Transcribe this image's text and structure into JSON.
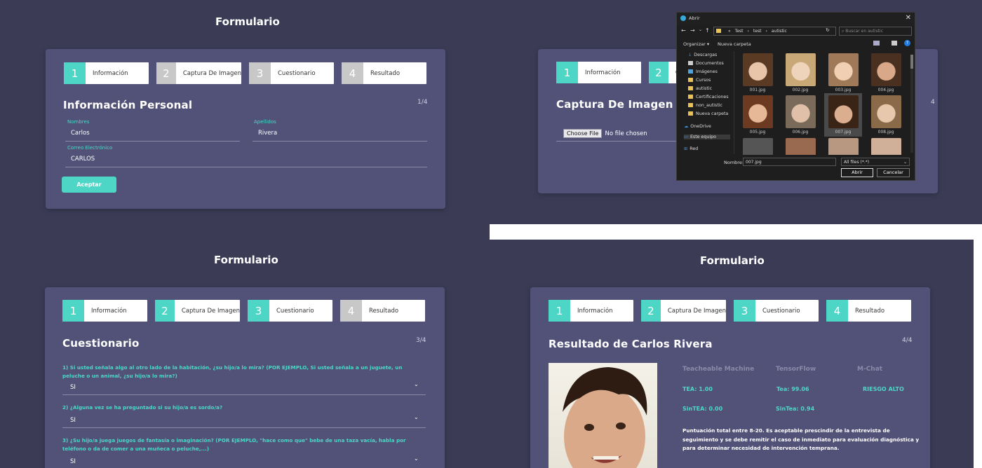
{
  "steps": [
    "Información",
    "Captura De Imagen",
    "Cuestionario",
    "Resultado"
  ],
  "step_nums": [
    "1",
    "2",
    "3",
    "4"
  ],
  "p1": {
    "title": "Formulario",
    "section": "Información Personal",
    "page": "1/4",
    "nombres_label": "Nombres",
    "nombres_value": "Carlos",
    "apellidos_label": "Apellidos",
    "apellidos_value": "Rivera",
    "correo_label": "Correo Electrónico",
    "correo_value": "CARLOS",
    "accept": "Aceptar"
  },
  "p2": {
    "section": "Captura De Imagen",
    "page": "4",
    "choose": "Choose File",
    "nofile": "No file chosen",
    "dialog": {
      "title": "Abrir",
      "crumbs": [
        "«",
        "Test",
        "test",
        "autistic"
      ],
      "search_placeholder": "Buscar en autistic",
      "organize": "Organizar ▾",
      "new_folder": "Nueva carpeta",
      "nav": [
        "Descargas",
        "Documentos",
        "Imágenes",
        "Cursos",
        "autistic",
        "Certificaciones",
        "non_autistic",
        "Nueva carpeta",
        "OneDrive",
        "Este equipo",
        "Red"
      ],
      "files": [
        "001.jpg",
        "002.jpg",
        "003.jpg",
        "004.jpg",
        "005.jpg",
        "006.jpg",
        "007.jpg",
        "008.jpg"
      ],
      "name_label": "Nombre:",
      "name_value": "007.jpg",
      "filter": "All files (*.*)",
      "open": "Abrir",
      "cancel": "Cancelar"
    }
  },
  "p3": {
    "title": "Formulario",
    "section": "Cuestionario",
    "page": "3/4",
    "questions": [
      "1) Si usted señala algo al otro lado de la habitación, ¿su hijo/a lo mira? (POR EJEMPLO, Si usted señala a un juguete, un peluche o un animal, ¿su hijo/a lo mira?)",
      "2) ¿Alguna vez se ha preguntado si su hijo/a es sordo/a?",
      "3) ¿Su hijo/a juega juegos de fantasía o imaginación? (POR EJEMPLO, \"hace como que\" bebe de una taza vacía, habla por teléfono o da de comer a una muñeca o peluche,...)"
    ],
    "answers": [
      "SI",
      "SI",
      "SI"
    ]
  },
  "p4": {
    "title": "Formulario",
    "section": "Resultado de Carlos Rivera",
    "page": "4/4",
    "col_tm": "Teacheable Machine",
    "col_tf": "TensorFlow",
    "col_mc": "M-Chat",
    "tm_tea": "TEA: 1.00",
    "tm_sintea": "SinTEA: 0.00",
    "tf_tea": "Tea: 99.06",
    "tf_sintea": "SinTea: 0.94",
    "mchat": "RIESGO ALTO",
    "text": "Puntuación total entre 8-20. Es aceptable prescindir de la entrevista de seguimiento y se debe remitir el caso de inmediato para evaluación diagnóstica y para determinar necesidad de intervención temprana."
  },
  "colors": {
    "accent": "#4dd6c6",
    "card": "#525279",
    "bg": "#3b3b56",
    "step_off": "#c8c8c8"
  }
}
